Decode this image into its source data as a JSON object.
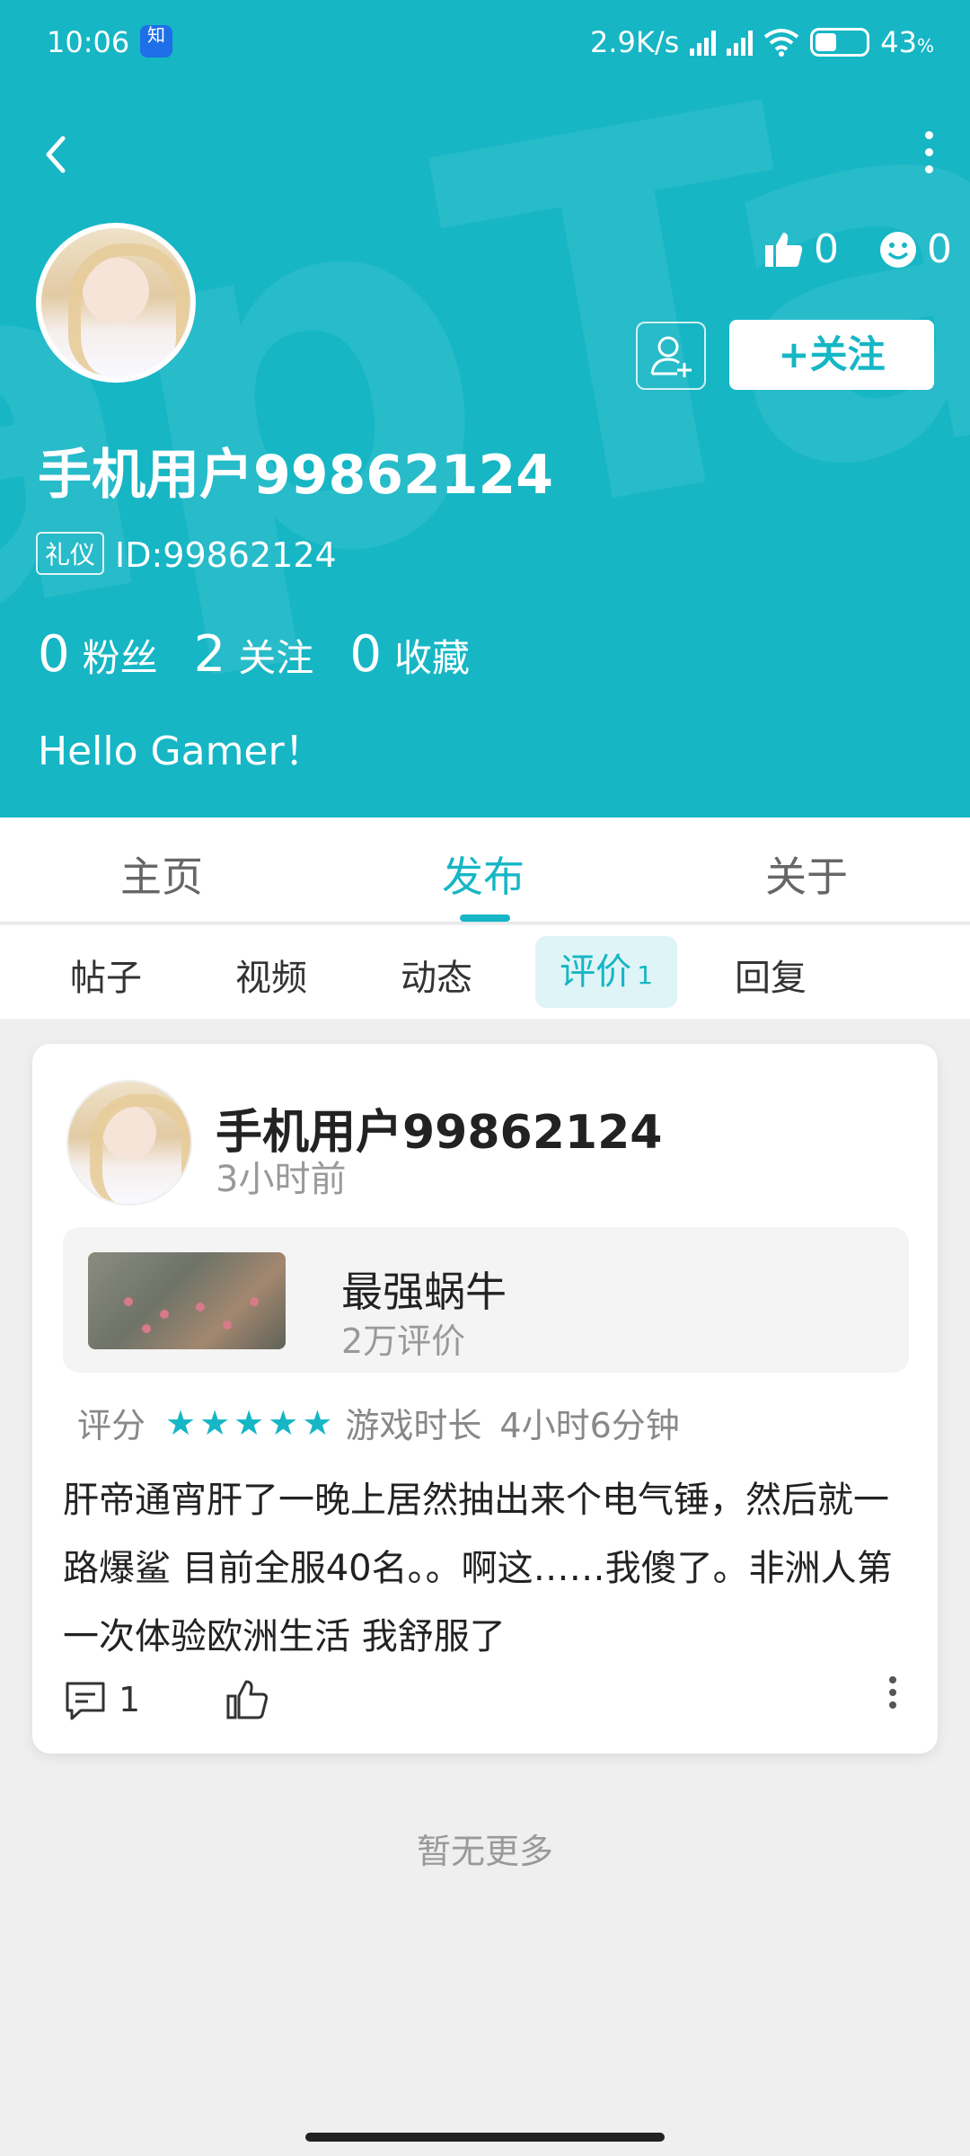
{
  "status_bar": {
    "time": "10:06",
    "app_icon_text": "知",
    "net_speed": "2.9K/s",
    "battery": "43",
    "battery_unit": "%",
    "battery_level": 0.43
  },
  "profile": {
    "username": "手机用户99862124",
    "badge": "礼仪",
    "id_text": "ID:99862124",
    "likes": "0",
    "emotes": "0",
    "follow_button": "+关注",
    "stats": [
      {
        "num": "0",
        "label": "粉丝"
      },
      {
        "num": "2",
        "label": "关注"
      },
      {
        "num": "0",
        "label": "收藏"
      }
    ],
    "bio": "Hello Gamer！"
  },
  "main_tabs": [
    {
      "label": "主页"
    },
    {
      "label": "发布"
    },
    {
      "label": "关于"
    }
  ],
  "sub_tabs": [
    {
      "label": "帖子"
    },
    {
      "label": "视频"
    },
    {
      "label": "动态"
    },
    {
      "label": "评价",
      "count": "1"
    },
    {
      "label": "回复"
    }
  ],
  "review": {
    "user": "手机用户99862124",
    "time": "3小时前",
    "game_name": "最强蜗牛",
    "game_reviews": "2万评价",
    "rating_label": "评分",
    "rating_stars": 5,
    "playtime_label": "游戏时长",
    "playtime": "4小时6分钟",
    "text": "肝帝通宵肝了一晚上居然抽出来个电气锤，然后就一路爆鲨 目前全服40名。。啊这……我傻了。非洲人第一次体验欧洲生活 我舒服了",
    "comment_count": "1"
  },
  "footer": {
    "no_more": "暂无更多"
  },
  "colors": {
    "accent": "#16b6c5",
    "background": "#efefef"
  }
}
